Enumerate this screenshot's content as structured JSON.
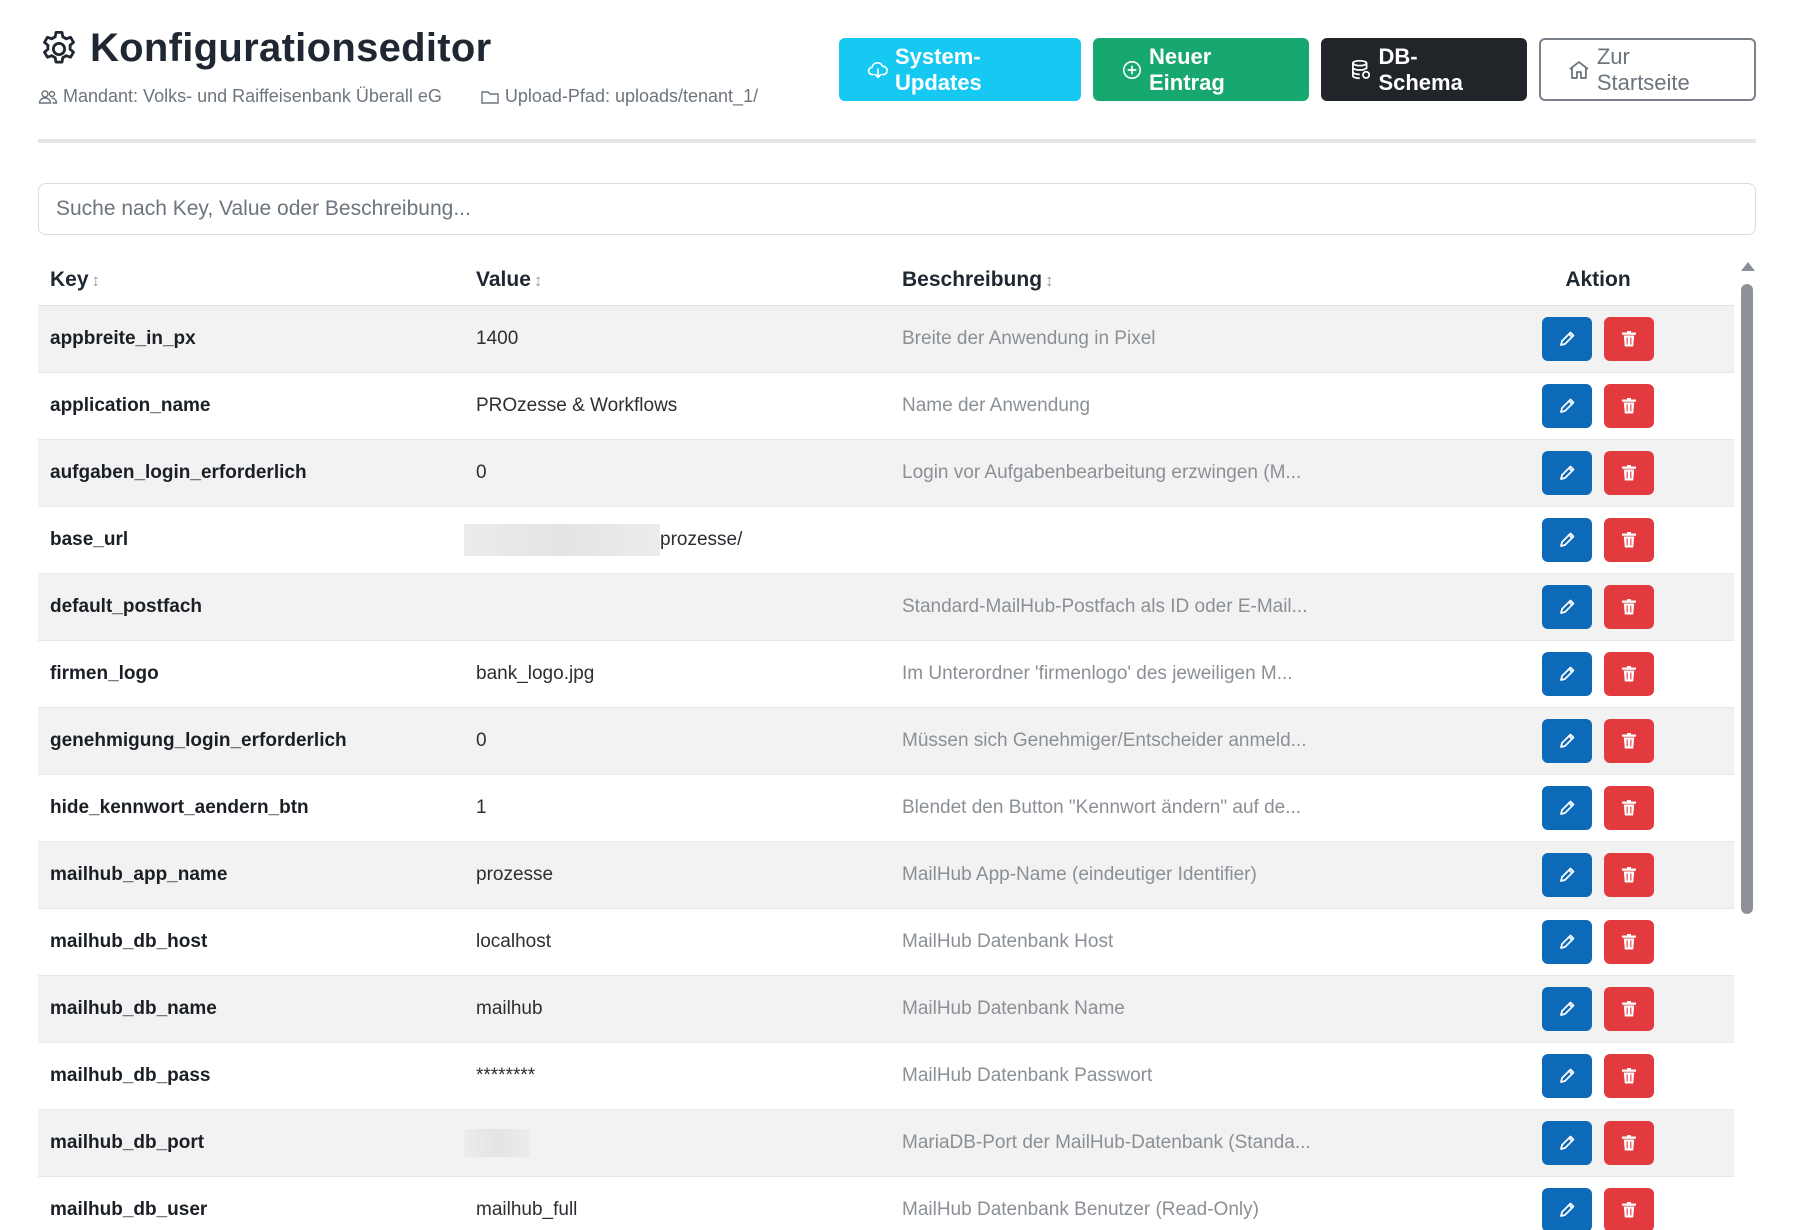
{
  "header": {
    "title": "Konfigurationseditor",
    "title_icon": "gear-icon",
    "tenant_label": "Mandant: Volks- und Raiffeisenbank Überall eG",
    "upload_label": "Upload-Pfad: uploads/tenant_1/"
  },
  "toolbar": {
    "system_updates": "System-Updates",
    "new_entry": "Neuer Eintrag",
    "db_schema": "DB-Schema",
    "home": "Zur Startseite"
  },
  "search": {
    "placeholder": "Suche nach Key, Value oder Beschreibung..."
  },
  "table": {
    "headers": {
      "key": "Key",
      "value": "Value",
      "description": "Beschreibung",
      "action": "Aktion",
      "sort_glyph": "↕"
    },
    "rows": [
      {
        "key": "appbreite_in_px",
        "value": "1400",
        "description": "Breite der Anwendung in Pixel"
      },
      {
        "key": "application_name",
        "value": "PROzesse & Workflows",
        "description": "Name der Anwendung"
      },
      {
        "key": "aufgaben_login_erforderlich",
        "value": "0",
        "description": "Login vor Aufgabenbearbeitung erzwingen (M..."
      },
      {
        "key": "base_url",
        "value": "prozesse/",
        "value_redacted": true,
        "description": ""
      },
      {
        "key": "default_postfach",
        "value": "",
        "description": "Standard-MailHub-Postfach als ID oder E-Mail..."
      },
      {
        "key": "firmen_logo",
        "value": "bank_logo.jpg",
        "description": "Im Unterordner 'firmenlogo' des jeweiligen M..."
      },
      {
        "key": "genehmigung_login_erforderlich",
        "value": "0",
        "description": "Müssen sich Genehmiger/Entscheider anmeld..."
      },
      {
        "key": "hide_kennwort_aendern_btn",
        "value": "1",
        "description": "Blendet den Button \"Kennwort ändern\" auf de..."
      },
      {
        "key": "mailhub_app_name",
        "value": "prozesse",
        "description": "MailHub App-Name (eindeutiger Identifier)"
      },
      {
        "key": "mailhub_db_host",
        "value": "localhost",
        "description": "MailHub Datenbank Host"
      },
      {
        "key": "mailhub_db_name",
        "value": "mailhub",
        "description": "MailHub Datenbank Name"
      },
      {
        "key": "mailhub_db_pass",
        "value": "********",
        "description": "MailHub Datenbank Passwort"
      },
      {
        "key": "mailhub_db_port",
        "value": "",
        "value_redacted": true,
        "description": "MariaDB-Port der MailHub-Datenbank (Standa..."
      },
      {
        "key": "mailhub_db_user",
        "value": "mailhub_full",
        "description": "MailHub Datenbank Benutzer (Read-Only)"
      }
    ]
  },
  "colors": {
    "cyan": "#15c9f2",
    "green": "#16a86f",
    "dark": "#212529",
    "edit": "#0d6ab8",
    "delete": "#e23a3f"
  }
}
